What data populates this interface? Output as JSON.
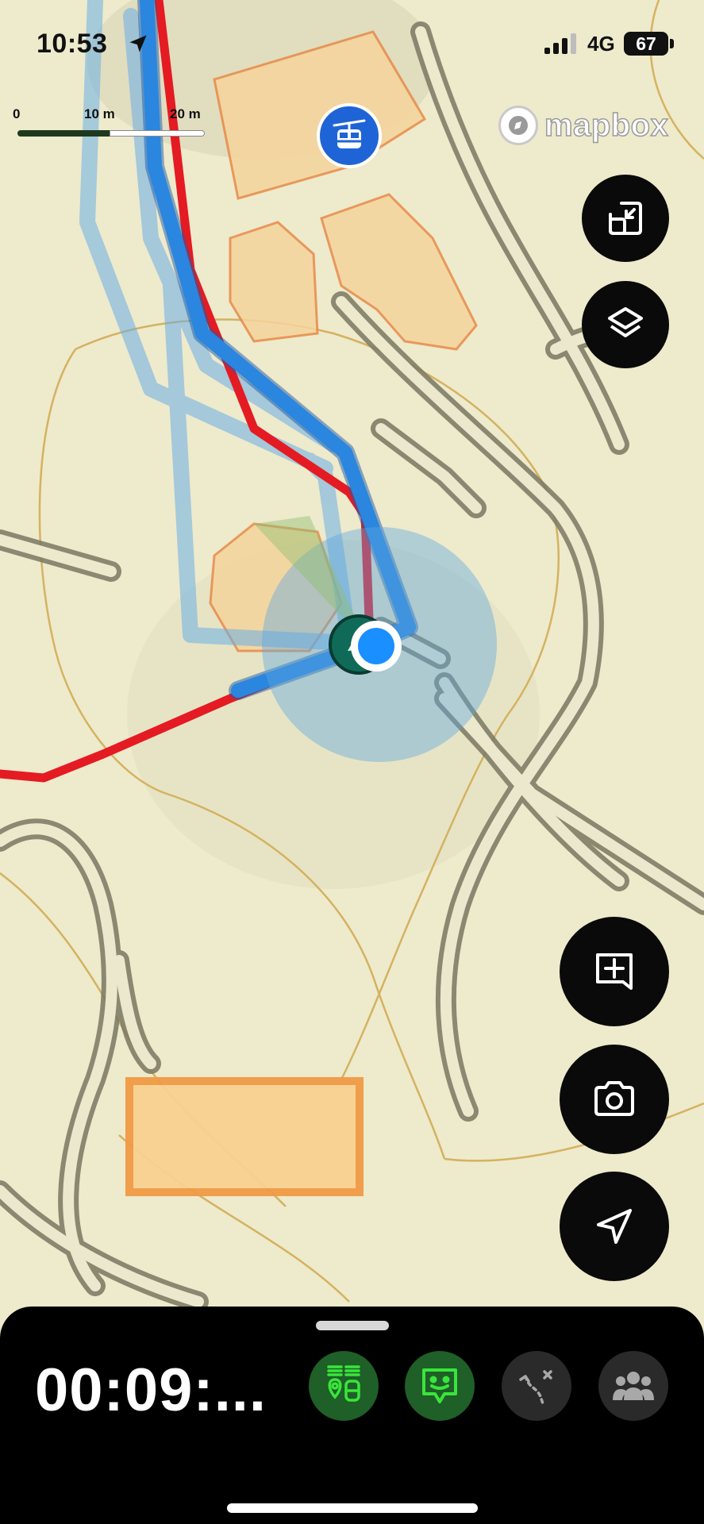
{
  "status_bar": {
    "time": "10:53",
    "network": "4G",
    "battery": "67"
  },
  "scale_bar": {
    "label_0": "0",
    "label_10": "10 m",
    "label_20": "20 m"
  },
  "map": {
    "attribution": "mapbox",
    "poi_icon": "gondola-icon"
  },
  "buttons": {
    "collapse": "collapse-map-icon",
    "layers": "layers-icon",
    "add_note": "add-note-icon",
    "camera": "camera-icon",
    "locate": "navigation-arrow-icon"
  },
  "bottom_sheet": {
    "timer": "00:09:...",
    "controls": [
      "track-stats-icon",
      "waypoint-icon",
      "route-icon",
      "group-icon"
    ]
  },
  "colors": {
    "track_red": "#e41b23",
    "track_blue": "#2a7fd9",
    "location_dot": "#1a8fff",
    "active_control": "#1f5f28",
    "active_icon": "#39e53a"
  }
}
